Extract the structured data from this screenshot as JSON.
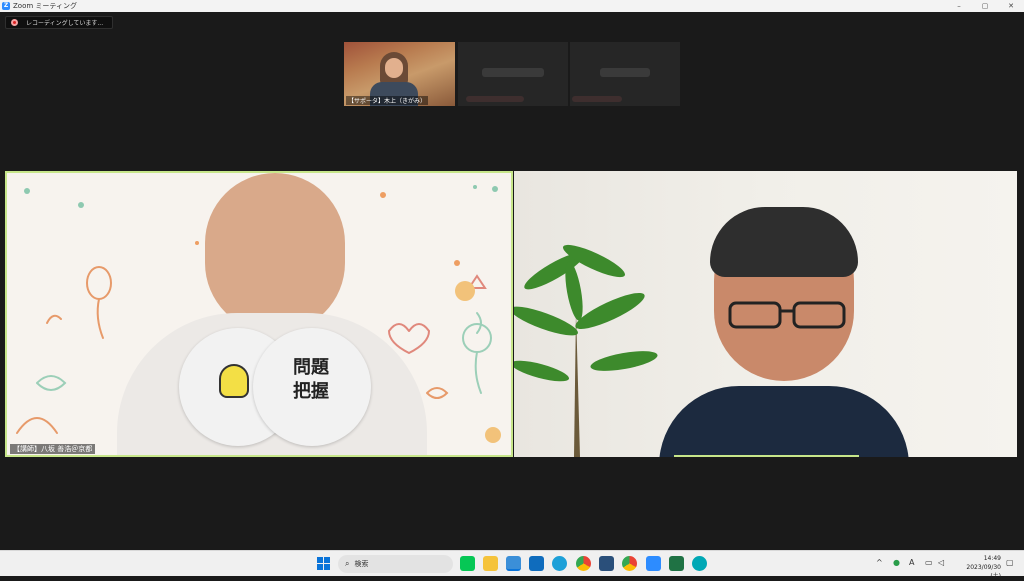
{
  "window": {
    "title": "Zoom ミーティング",
    "logo_letter": "Z",
    "minimize": "–",
    "maximize": "▢",
    "close": "✕"
  },
  "recording": {
    "status_text": "レコーディングしています..."
  },
  "thumbnails": [
    {
      "name": "【サポータ】木上（きがみ）"
    }
  ],
  "videos": {
    "left_name": "【講師】八坂 善浩＠京都",
    "fan_text_line1": "問題",
    "fan_text_line2": "把握"
  },
  "taskbar": {
    "search_placeholder": "検索",
    "search_glyph": "⌕",
    "ime_indicator": "A",
    "tray_chevron": "^",
    "clock_time": "14:49",
    "clock_date": "2023/09/30 (土)"
  },
  "colors": {
    "active_speaker_border": "#c7e68a",
    "zoom_blue": "#2d8cff"
  }
}
